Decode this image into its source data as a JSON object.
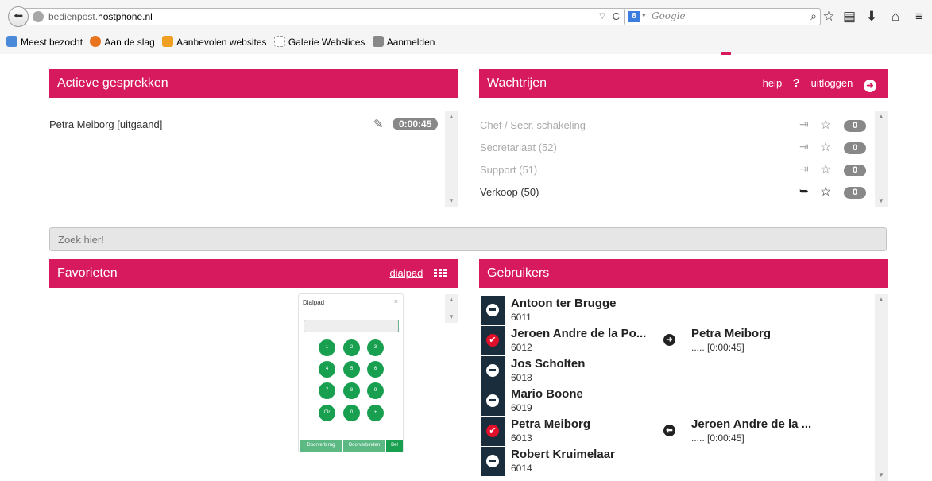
{
  "browser": {
    "url_host_prefix": "bedienpost.",
    "url_host_domain": "hostphone.nl",
    "search_placeholder": "Google",
    "bookmarks": [
      "Meest bezocht",
      "Aan de slag",
      "Aanbevolen websites",
      "Galerie Webslices",
      "Aanmelden"
    ]
  },
  "active_calls": {
    "title": "Actieve gesprekken",
    "items": [
      {
        "name": "Petra Meiborg [uitgaand]",
        "timer": "0:00:45"
      }
    ]
  },
  "queues": {
    "title": "Wachtrijen",
    "help_label": "help",
    "help_symbol": "?",
    "logout_label": "uitloggen",
    "items": [
      {
        "name": "Chef / Secr. schakeling",
        "count": "0"
      },
      {
        "name": "Secretariaat (52)",
        "count": "0"
      },
      {
        "name": "Support (51)",
        "count": "0"
      },
      {
        "name": "Verkoop (50)",
        "count": "0"
      }
    ]
  },
  "search": {
    "placeholder": "Zoek hier!"
  },
  "favorites": {
    "title": "Favorieten",
    "dialpad_label": "dialpad",
    "dialpad": {
      "title": "Dialpad",
      "close": "×",
      "keys": [
        "1",
        "2",
        "3",
        "4",
        "5",
        "6",
        "7",
        "8",
        "9",
        "Clr",
        "0",
        "+"
      ],
      "buttons": [
        "Doorverb rug",
        "Doorverbinden",
        "Bel"
      ]
    }
  },
  "users": {
    "title": "Gebruikers",
    "items": [
      {
        "name": "Antoon ter Brugge",
        "ext": "6011"
      },
      {
        "name": "Jeroen Andre de la Po...",
        "ext": "6012",
        "peer": "Petra Meiborg",
        "peer_time": "..... [0:00:45]"
      },
      {
        "name": "Jos Scholten",
        "ext": "6018"
      },
      {
        "name": "Mario Boone",
        "ext": "6019"
      },
      {
        "name": "Petra Meiborg",
        "ext": "6013",
        "peer": "Jeroen Andre de la ...",
        "peer_time": "..... [0:00:45]"
      },
      {
        "name": "Robert Kruimelaar",
        "ext": "6014"
      }
    ]
  },
  "colors": {
    "accent": "#d7195d",
    "user_status_bg": "#1a2d3d",
    "busy": "#e0102a",
    "dialpad_green": "#18a050"
  }
}
